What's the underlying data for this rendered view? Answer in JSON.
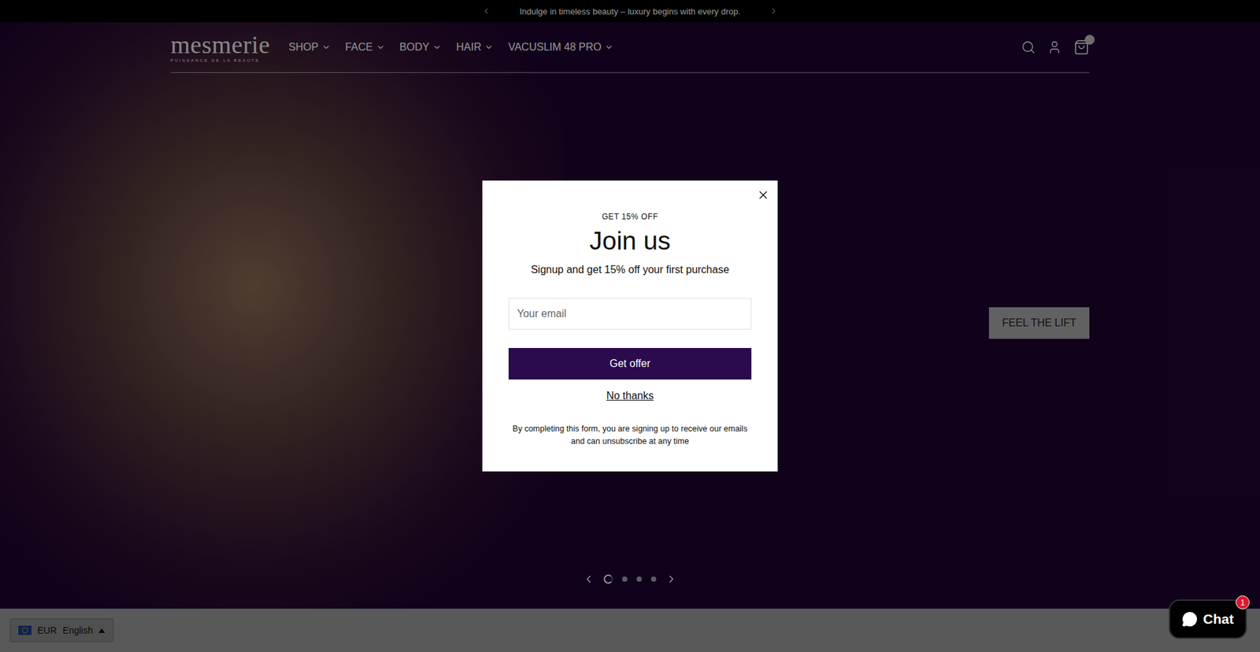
{
  "announcement": {
    "text": "Indulge in timeless beauty – luxury begins with every drop."
  },
  "logo": {
    "name": "mesmerie",
    "tagline": "PUISSANCE DE LA BEAUTE"
  },
  "nav": [
    {
      "label": "SHOP"
    },
    {
      "label": "FACE"
    },
    {
      "label": "BODY"
    },
    {
      "label": "HAIR"
    },
    {
      "label": "VACUSLIM 48 PRO"
    }
  ],
  "hero": {
    "button": "FEEL THE LIFT",
    "slides": [
      {
        "selected": true
      },
      {
        "selected": false
      },
      {
        "selected": false
      },
      {
        "selected": false
      }
    ]
  },
  "popup": {
    "eyebrow": "GET 15% OFF",
    "title": "Join us",
    "subtitle": "Signup and get 15% off your first purchase",
    "email_placeholder": "Your email",
    "submit": "Get offer",
    "decline": "No thanks",
    "disclaimer": "By completing this form, you are signing up to receive our emails and can unsubscribe at any time"
  },
  "locale": {
    "currency": "EUR",
    "language": "English"
  },
  "chat": {
    "label": "Chat",
    "badge": "1"
  }
}
